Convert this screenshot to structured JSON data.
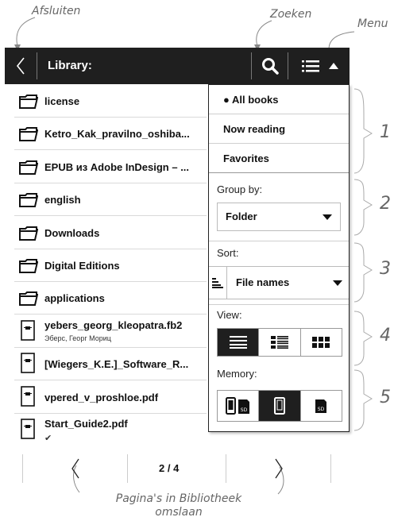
{
  "callouts": {
    "close": "Afsluiten",
    "search": "Zoeken",
    "menu": "Menu",
    "pages_line1": "Pagina's in Bibliotheek",
    "pages_line2": "omslaan"
  },
  "header": {
    "title": "Library:"
  },
  "library": {
    "items": [
      {
        "type": "folder",
        "name": "license"
      },
      {
        "type": "folder",
        "name": "Ketro_Kak_pravilno_oshiba..."
      },
      {
        "type": "folder",
        "name": "EPUB из Adobe InDesign – ..."
      },
      {
        "type": "folder",
        "name": "english"
      },
      {
        "type": "folder",
        "name": "Downloads"
      },
      {
        "type": "folder",
        "name": "Digital Editions"
      },
      {
        "type": "folder",
        "name": "applications"
      },
      {
        "type": "book",
        "name": "yebers_georg_kleopatra.fb2",
        "author": "Эберс, Георг Мориц"
      },
      {
        "type": "book",
        "name": "[Wiegers_K.E.]_Software_R..."
      },
      {
        "type": "book",
        "name": "vpered_v_proshloe.pdf"
      },
      {
        "type": "book",
        "name": "Start_Guide2.pdf",
        "mark": "✔"
      }
    ]
  },
  "menu": {
    "filters": [
      "● All books",
      "Now reading",
      "Favorites"
    ],
    "group_label": "Group by:",
    "group_value": "Folder",
    "sort_label": "Sort:",
    "sort_value": "File names",
    "view_label": "View:",
    "view_selected": "list",
    "memory_label": "Memory:",
    "memory_selected": "internal"
  },
  "bracket_numbers": [
    "1",
    "2",
    "3",
    "4",
    "5"
  ],
  "pager": {
    "text": "2 / 4"
  }
}
